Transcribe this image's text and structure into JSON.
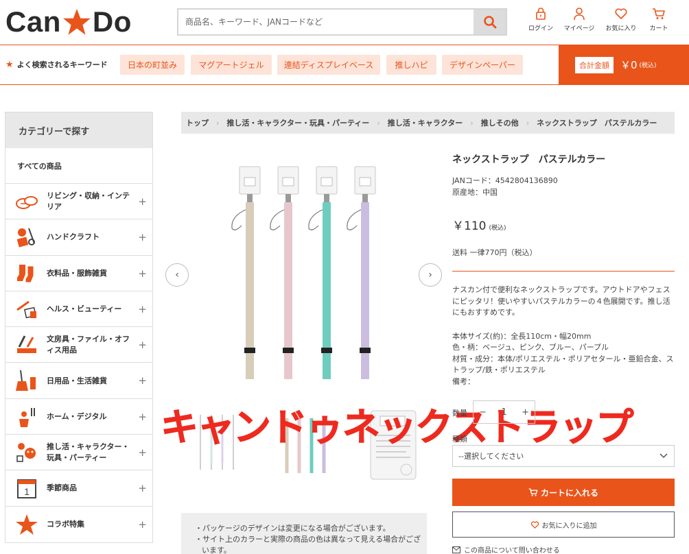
{
  "header": {
    "logo_left": "Can",
    "logo_right": "Do",
    "search_placeholder": "商品名、キーワード、JANコードなど",
    "icons": [
      {
        "name": "login",
        "label": "ログイン"
      },
      {
        "name": "mypage",
        "label": "マイページ"
      },
      {
        "name": "favorites",
        "label": "お気に入り"
      },
      {
        "name": "cart",
        "label": "カート"
      }
    ]
  },
  "keywords": {
    "title": "よく検索されるキーワード",
    "items": [
      "日本の町並み",
      "マグアートジェル",
      "連結ディスプレイベース",
      "推しハピ",
      "デザインペーパー"
    ]
  },
  "total": {
    "label": "合計金額",
    "amount": "￥0",
    "tax": "(税込)"
  },
  "sidebar": {
    "title": "カテゴリーで探す",
    "all_label": "すべての商品",
    "items": [
      {
        "label": "リビング・収納・インテリア",
        "icon": "living-icon"
      },
      {
        "label": "ハンドクラフト",
        "icon": "handcraft-icon"
      },
      {
        "label": "衣料品・服飾雑貨",
        "icon": "clothing-icon"
      },
      {
        "label": "ヘルス・ビューティー",
        "icon": "beauty-icon"
      },
      {
        "label": "文房具・ファイル・オフィス用品",
        "icon": "stationery-icon"
      },
      {
        "label": "日用品・生活雑貨",
        "icon": "household-icon"
      },
      {
        "label": "ホーム・デジタル",
        "icon": "home-digital-icon"
      },
      {
        "label": "推し活・キャラクター・玩具・パーティー",
        "icon": "character-icon"
      },
      {
        "label": "季節商品",
        "icon": "calendar-icon"
      },
      {
        "label": "コラボ特集",
        "icon": "star-icon"
      }
    ]
  },
  "breadcrumb": [
    "トップ",
    "推し活・キャラクター・玩具・パーティー",
    "推し活・キャラクター",
    "推しその他",
    "ネックストラップ　パステルカラー"
  ],
  "product": {
    "name": "ネックストラップ　パステルカラー",
    "jan": "JANコード：4542804136890",
    "origin": "原産地：中国",
    "price": "￥110",
    "price_tax": "(税込)",
    "shipping": "送料 一律770円（税込）",
    "description": "ナスカン付で便利なネックストラップです。アウトドアやフェスにピッタリ！使いやすいパステルカラーの４色展開です。推し活にもおすすめです。",
    "specs": [
      "本体サイズ(約)：全長110cm・幅20mm",
      "色・柄：ベージュ、ピンク、ブルー、パープル",
      "材質・成分：本体/ポリエステル・ポリアセタール・亜鉛合金、ストラップ/鉄・ポリエステル",
      "備考："
    ],
    "strap_colors": [
      "#d8cdb9",
      "#e8c7cc",
      "#6ecdbf",
      "#cbbde0"
    ],
    "qty_label": "数量",
    "qty_value": "1",
    "qty_minus": "−",
    "qty_plus": "+",
    "kind_label": "種類",
    "select_placeholder": "--選択してください",
    "cart_button": "カートに入れる",
    "fav_button": "お気に入りに追加",
    "inquiry": "この商品について問い合わせる"
  },
  "overlay_text": "キャンドゥネックストラップ",
  "notes": [
    "・パッケージのデザインは変更になる場合がございます。",
    "・サイト上のカラーと実際の商品の色は異なって見える場合がございます。"
  ],
  "colors": {
    "accent": "#e9541a",
    "keyword_bg": "#fde3d8",
    "overlay": "#ee2a1f"
  }
}
